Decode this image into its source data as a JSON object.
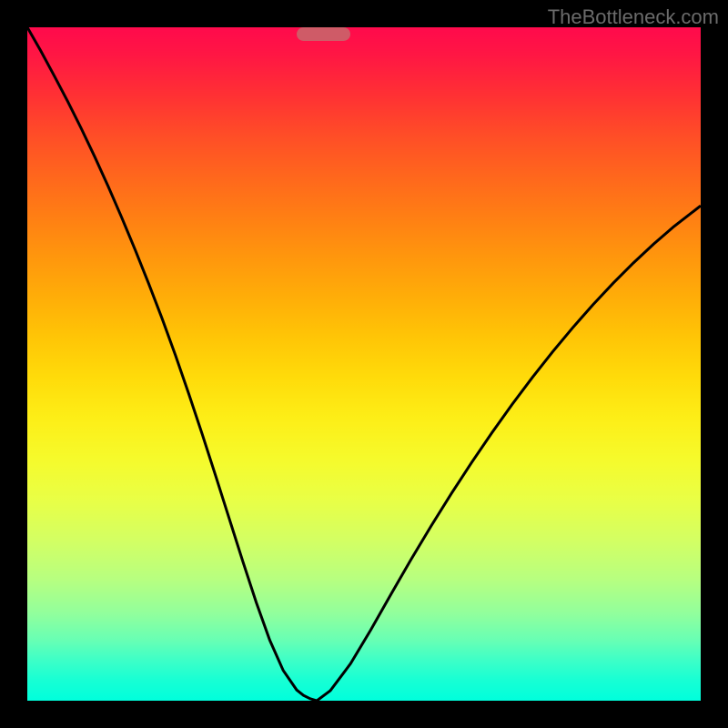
{
  "watermark": "TheBottleneck.com",
  "colors": {
    "background": "#000000",
    "marker": "#cf5b67",
    "curve": "#000000"
  },
  "chart_data": {
    "type": "line",
    "title": "",
    "xlabel": "",
    "ylabel": "",
    "xlim": [
      0,
      100
    ],
    "ylim": [
      0,
      100
    ],
    "optimal_x": 43,
    "marker": {
      "x_start": 40,
      "x_end": 48,
      "y": 99,
      "height": 2
    },
    "series": [
      {
        "name": "left",
        "x": [
          0,
          2,
          4,
          6,
          8,
          10,
          12,
          14,
          16,
          18,
          20,
          22,
          24,
          26,
          28,
          30,
          32,
          34,
          36,
          38,
          40,
          41,
          42,
          43
        ],
        "y": [
          100,
          96.5,
          92.8,
          89,
          85,
          80.8,
          76.4,
          71.8,
          67,
          62,
          56.8,
          51.3,
          45.5,
          39.5,
          33.3,
          27,
          20.7,
          14.6,
          9,
          4.5,
          1.6,
          0.8,
          0.3,
          0
        ]
      },
      {
        "name": "right",
        "x": [
          43,
          45,
          48,
          51,
          54,
          57,
          60,
          63,
          66,
          69,
          72,
          75,
          78,
          81,
          84,
          87,
          90,
          93,
          96,
          100
        ],
        "y": [
          0,
          1.5,
          5.5,
          10.5,
          15.8,
          21,
          26,
          30.8,
          35.4,
          39.8,
          44,
          48,
          51.8,
          55.4,
          58.8,
          62,
          65,
          67.8,
          70.4,
          73.5
        ]
      }
    ]
  }
}
